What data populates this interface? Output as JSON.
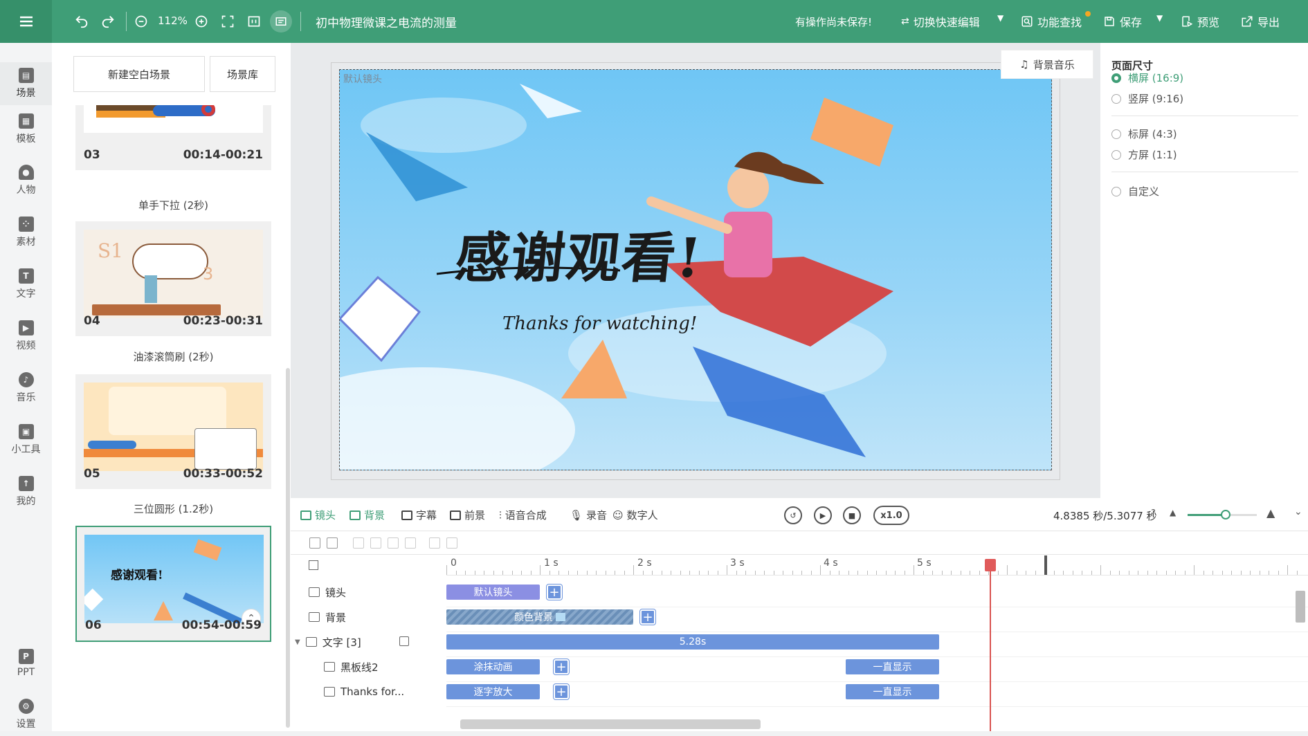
{
  "topbar": {
    "zoom": "112%",
    "doc_title": "初中物理微课之电流的测量",
    "unsaved_notice": "有操作尚未保存!",
    "quick_edit": "切换快速编辑",
    "feature_search": "功能查找",
    "save": "保存",
    "preview": "预览",
    "export": "导出"
  },
  "leftnav": {
    "items": [
      {
        "label": "场景",
        "icon": "scene-icon"
      },
      {
        "label": "模板",
        "icon": "template-icon"
      },
      {
        "label": "人物",
        "icon": "person-icon"
      },
      {
        "label": "素材",
        "icon": "material-icon"
      },
      {
        "label": "文字",
        "icon": "text-icon"
      },
      {
        "label": "视频",
        "icon": "video-icon"
      },
      {
        "label": "音乐",
        "icon": "music-icon"
      },
      {
        "label": "小工具",
        "icon": "toolbox-icon"
      },
      {
        "label": "我的",
        "icon": "my-icon"
      },
      {
        "label": "PPT",
        "icon": "ppt-icon"
      },
      {
        "label": "设置",
        "icon": "settings-icon"
      }
    ]
  },
  "panel": {
    "new_scene": "新建空白场景",
    "scene_library": "场景库",
    "scenes": [
      {
        "num": "03",
        "time": "00:14-00:21"
      },
      {
        "num": "04",
        "time": "00:23-00:31"
      },
      {
        "num": "05",
        "time": "00:33-00:52"
      },
      {
        "num": "06",
        "time": "00:54-00:59",
        "thumb_title": "感谢观看!"
      }
    ],
    "transitions": [
      "单手下拉 (2秒)",
      "油漆滚筒刷 (2秒)",
      "三位圆形 (1.2秒)"
    ]
  },
  "canvas": {
    "lens_label": "默认镜头",
    "bgm": "背景音乐",
    "title": "感谢观看!",
    "subtitle": "Thanks for watching!"
  },
  "rightpanel": {
    "title": "页面尺寸",
    "options": [
      "横屏 (16:9)",
      "竖屏 (9:16)",
      "标屏 (4:3)",
      "方屏 (1:1)",
      "自定义"
    ],
    "selected": "横屏 (16:9)"
  },
  "timeline_toolbar": {
    "tabs": [
      "镜头",
      "背景",
      "字幕",
      "前景",
      "语音合成",
      "录音",
      "数字人"
    ],
    "speed": "x1.0",
    "time_readout": "4.8385 秒/5.3077 秒",
    "zoom_level": 0.55
  },
  "timeline": {
    "ruler": [
      "0",
      "1 s",
      "2 s",
      "3 s",
      "4 s",
      "5 s"
    ],
    "tracks": [
      {
        "label": "镜头",
        "clips": [
          "默认镜头"
        ]
      },
      {
        "label": "背景",
        "clips": [
          "颜色背景"
        ]
      },
      {
        "label": "文字 [3]",
        "clips": [
          "5.28s"
        ]
      },
      {
        "label": "黑板线2",
        "clips": [
          "涂抹动画",
          "一直显示"
        ]
      },
      {
        "label": "Thanks for...",
        "clips": [
          "逐字放大",
          "一直显示"
        ]
      }
    ]
  },
  "colors": {
    "brand": "#3f9e77",
    "clip": "#6c94dc",
    "playhead": "#d9534f"
  }
}
